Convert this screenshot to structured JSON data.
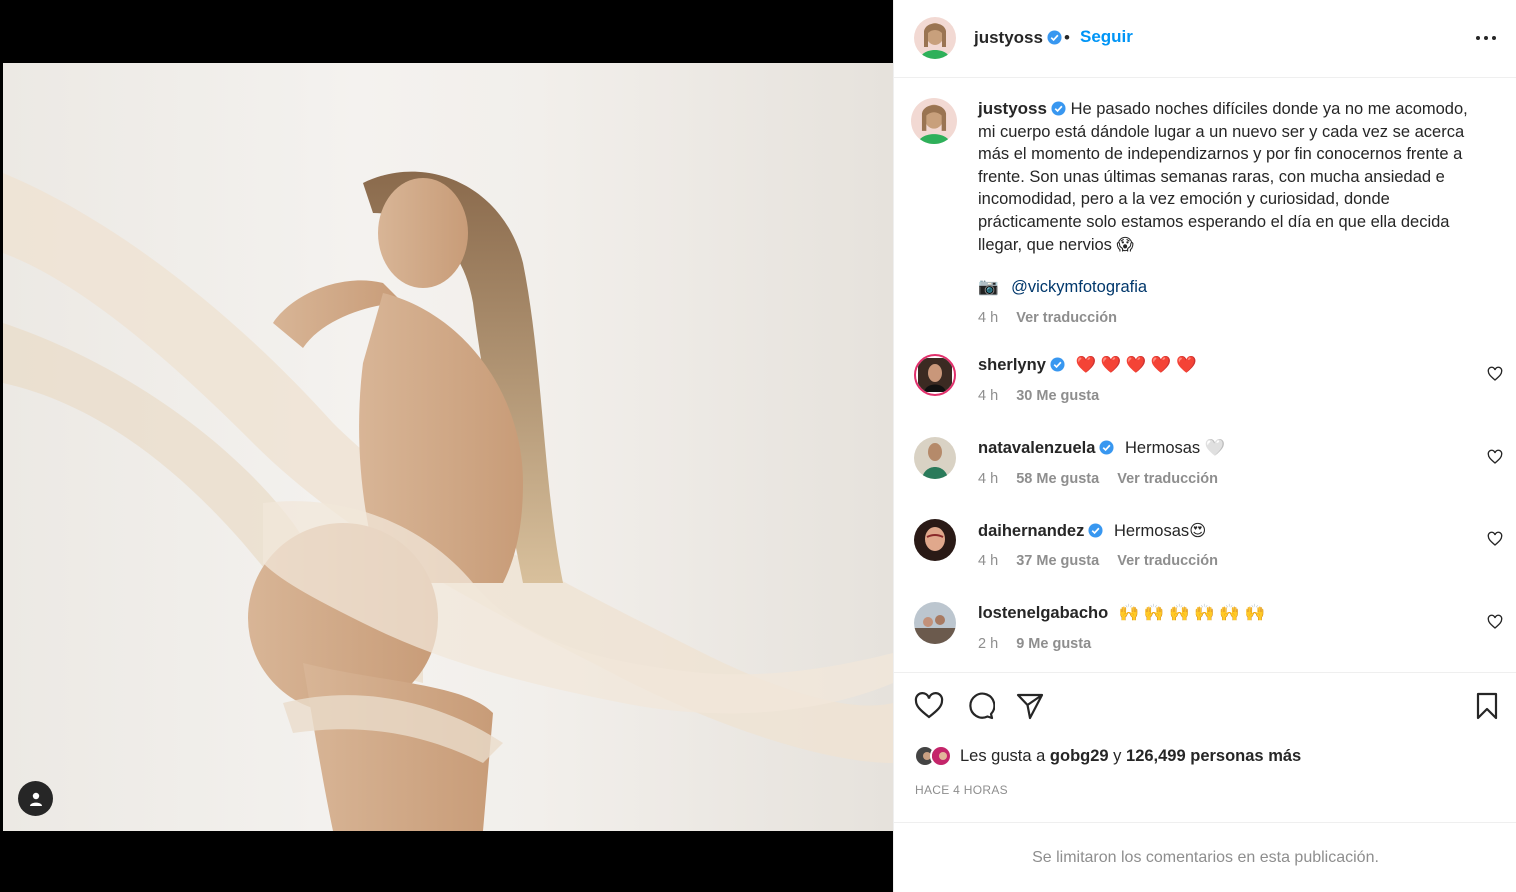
{
  "post": {
    "username": "justyoss",
    "follow_label": "Seguir",
    "separator": "•",
    "caption": "He pasado noches difíciles donde ya no me acomodo, mi cuerpo está dándole lugar a un nuevo ser y cada vez se acerca más el momento de independizarnos y por fin conocernos frente a frente. Son unas últimas semanas raras, con mucha ansiedad e incomodidad, pero a la vez emoción y curiosidad, donde prácticamente solo estamos esperando el día en que ella decida llegar, que nervios 😱",
    "credit_icon": "📷",
    "credit_mention": "@vickymfotografia",
    "caption_time": "4 h",
    "translate_label": "Ver traducción",
    "accent_color": "#0095f6",
    "verified_color": "#3897f0"
  },
  "comments": [
    {
      "username": "sherlyny",
      "text": "❤️ ❤️ ❤️ ❤️ ❤️",
      "time": "4 h",
      "likes": "30 Me gusta",
      "translate": ""
    },
    {
      "username": "natavalenzuela",
      "text": "Hermosas 🤍",
      "time": "4 h",
      "likes": "58 Me gusta",
      "translate": "Ver traducción"
    },
    {
      "username": "daihernandez",
      "text": "Hermosas😍",
      "time": "4 h",
      "likes": "37 Me gusta",
      "translate": "Ver traducción"
    },
    {
      "username": "lostenelgabacho",
      "text": "🙌 🙌 🙌 🙌 🙌 🙌",
      "time": "2 h",
      "likes": "9 Me gusta",
      "translate": ""
    }
  ],
  "likes": {
    "prefix": "Les gusta a",
    "user": "gobg29",
    "conjunction": "y",
    "count": "126,499 personas más"
  },
  "post_time": "HACE 4 HORAS",
  "comments_limited": "Se limitaron los comentarios en esta publicación."
}
